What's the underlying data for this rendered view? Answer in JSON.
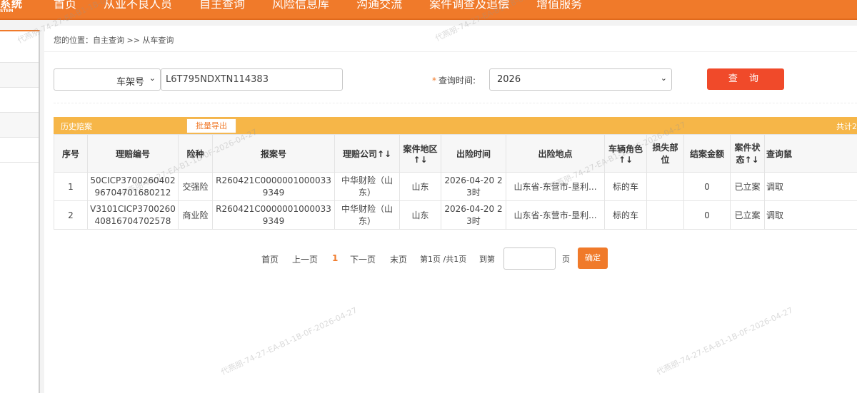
{
  "logo": {
    "line1": "系统",
    "line2": "STEM"
  },
  "nav": [
    "首页",
    "从业不良人员",
    "自主查询",
    "风险信息库",
    "沟通交流",
    "案件调查及追偿",
    "增值服务"
  ],
  "breadcrumb": "您的位置：自主查询 >> 从车查询",
  "search": {
    "type_label": "车架号",
    "vin_value": "L6T795NDXTN114383",
    "time_required_mark": "*",
    "time_label": "查询时间:",
    "year_value": "2026",
    "query_button": "查 询"
  },
  "history": {
    "title": "历史赔案",
    "export_button": "批量导出",
    "total": "共计2"
  },
  "table": {
    "headers": [
      "序号",
      "理赔编号",
      "险种",
      "报案号",
      "理赔公司↑↓",
      "案件地区↑↓",
      "出险时间",
      "出险地点",
      "车辆角色↑↓",
      "损失部位",
      "结案金额",
      "案件状态↑↓",
      "查询鼠"
    ],
    "rows": [
      [
        "1",
        "50CICP370026040296704701680212",
        "交强险",
        "R260421C00000010000339349",
        "中华财险（山东）",
        "山东",
        "2026-04-20 23时",
        "山东省-东营市-垦利...",
        "标的车",
        "",
        "0",
        "已立案",
        "调取"
      ],
      [
        "2",
        "V3101CICP370026040816704702578",
        "商业险",
        "R260421C00000010000339349",
        "中华财险（山东）",
        "山东",
        "2026-04-20 23时",
        "山东省-东营市-垦利...",
        "标的车",
        "",
        "0",
        "已立案",
        "调取"
      ]
    ]
  },
  "pager": {
    "first": "首页",
    "prev": "上一页",
    "current": "1",
    "next": "下一页",
    "last": "末页",
    "info": "第1页 /共1页",
    "goto": "到第",
    "page_unit": "页",
    "ok": "确定"
  },
  "watermark": "代燕朋-74-27-EA-B1-1B-0F-2026-04-27",
  "colors": {
    "brand": "#f07a2a",
    "query_button": "#f04a2a",
    "history_bar": "#f6b648"
  }
}
